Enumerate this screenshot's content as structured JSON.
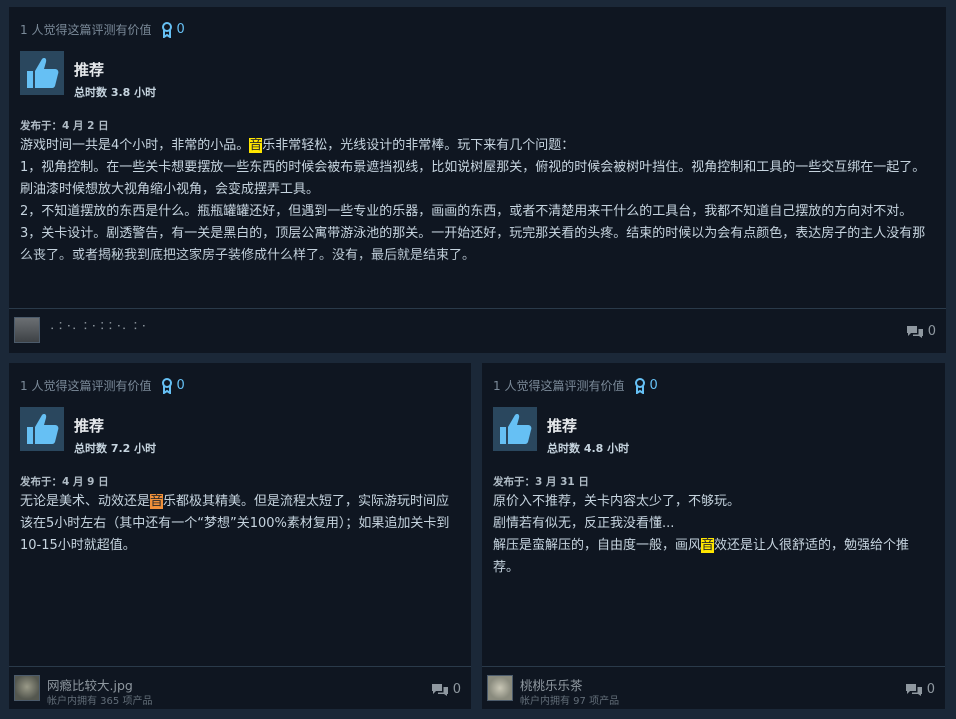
{
  "reviews": [
    {
      "helpful_text": "1 人觉得这篇评测有价值",
      "award_count": "0",
      "recommendation": "推荐",
      "hours": "总时数 3.8 小时",
      "posted": "发布于：4 月 2 日",
      "body": {
        "l1a": "游戏时间一共是4个小时，非常的小品。",
        "l1hl": "音",
        "l1b": "乐非常轻松，光线设计的非常棒。玩下来有几个问题：",
        "l2": "1，视角控制。在一些关卡想要摆放一些东西的时候会被布景遮挡视线，比如说树屋那关，俯视的时候会被树叶挡住。视角控制和工具的一些交互绑在一起了。刷油漆时候想放大视角缩小视角，会变成摆弄工具。",
        "l3": "2，不知道摆放的东西是什么。瓶瓶罐罐还好，但遇到一些专业的乐器，画画的东西，或者不清楚用来干什么的工具台，我都不知道自己摆放的方向对不对。",
        "l4": "3，关卡设计。剧透警告，有一关是黑白的，顶层公寓带游泳池的那关。一开始还好，玩完那关看的头疼。结束的时候以为会有点颜色，表达房子的主人没有那么丧了。或者揭秘我到底把这家房子装修成什么样了。没有，最后就是结束了。"
      },
      "author_name": "⠠⠨⠐⠄⠨⠐⠨⠨⠐⠄⠨⠐",
      "comment_count": "0"
    },
    {
      "helpful_text": "1 人觉得这篇评测有价值",
      "award_count": "0",
      "recommendation": "推荐",
      "hours": "总时数 7.2 小时",
      "posted": "发布于：4 月 9 日",
      "body": {
        "a": "无论是美术、动效还是",
        "hl": "音",
        "b": "乐都极其精美。但是流程太短了，实际游玩时间应该在5小时左右（其中还有一个“梦想”关100%素材复用）；如果追加关卡到10-15小时就超值。"
      },
      "author_name": "网瘾比较大.jpg",
      "author_owned": "帐户内拥有 365 项产品",
      "comment_count": "0"
    },
    {
      "helpful_text": "1 人觉得这篇评测有价值",
      "award_count": "0",
      "recommendation": "推荐",
      "hours": "总时数 4.8 小时",
      "posted": "发布于：3 月 31 日",
      "body": {
        "l1": "原价入不推荐，关卡内容太少了，不够玩。",
        "l2": "剧情若有似无，反正我没看懂...",
        "l3a": "解压是蛮解压的，自由度一般，画风",
        "l3hl": "音",
        "l3b": "效还是让人很舒适的，勉强给个推荐。"
      },
      "author_name": "桃桃乐乐茶",
      "author_owned": "帐户内拥有 97 项产品",
      "comment_count": "0"
    }
  ],
  "colors": {
    "background": "#1b2838",
    "card": "#0f1621",
    "accent": "#66c0f4",
    "highlight_yellow": "#ffe600",
    "highlight_orange": "#f0903a"
  }
}
